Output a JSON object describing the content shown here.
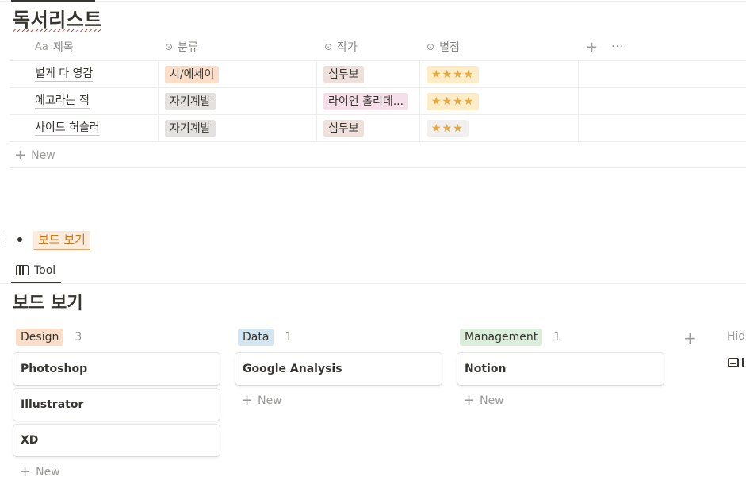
{
  "database": {
    "title": "독서리스트",
    "columns": {
      "title_prefix": "Aa",
      "title": "제목",
      "category": "분류",
      "author": "작가",
      "rating": "별점",
      "add": "+",
      "more": "···"
    },
    "rows": [
      {
        "title": "볕게 다 영감",
        "category": "시/에세이",
        "author": "심두보",
        "rating": "★★★★",
        "rating_value": 4
      },
      {
        "title": "에고라는 적",
        "category": "자기계발",
        "author": "라이언 홀리데...",
        "rating": "★★★★",
        "rating_value": 4
      },
      {
        "title": "사이드 허슬러",
        "category": "자기계발",
        "author": "심두보",
        "rating": "★★★",
        "rating_value": 3
      }
    ],
    "new_label": "New"
  },
  "board_link": {
    "label": "보드 보기"
  },
  "tabs": [
    {
      "label": "Tool"
    }
  ],
  "board": {
    "title": "보드 보기",
    "groups": [
      {
        "name": "Design",
        "count": "3",
        "cards": [
          "Photoshop",
          "Illustrator",
          "XD"
        ],
        "new_label": "New"
      },
      {
        "name": "Data",
        "count": "1",
        "cards": [
          "Google Analysis"
        ],
        "new_label": "New"
      },
      {
        "name": "Management",
        "count": "1",
        "cards": [
          "Notion"
        ],
        "new_label": "New"
      }
    ],
    "add_group": "+",
    "hidden_label": "Hidd"
  },
  "colors": {
    "tag_orange_bg": "#fadec9",
    "tag_gray_bg": "#e3e2e0",
    "tag_brown_bg": "#eee0da",
    "tag_pink_bg": "#f5e0e9",
    "tag_yellow_bg": "#fdecc8",
    "tag_blue_bg": "#d3e5ef",
    "tag_green_bg": "#dbeddb",
    "link_orange": "#d9730d",
    "star": "#e9a83b"
  },
  "icons": [
    "select-icon",
    "board-view-icon",
    "plus-icon",
    "more-icon",
    "inbox-icon",
    "drag-handle-icon"
  ]
}
